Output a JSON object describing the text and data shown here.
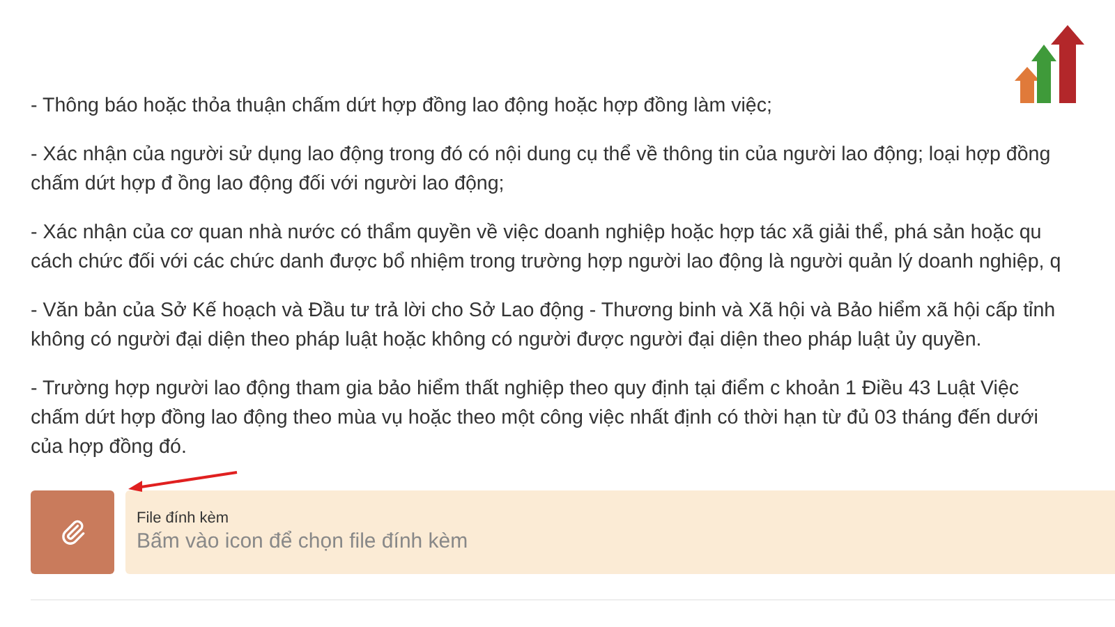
{
  "paragraphs": [
    {
      "lines": [
        "- Thông báo hoặc thỏa thuận chấm dứt hợp đồng lao động hoặc hợp đồng làm việc;"
      ]
    },
    {
      "lines": [
        "- Xác nhận của người sử dụng lao động trong đó có nội dung cụ thể về thông tin của người lao động; loại hợp đồng",
        "chấm dứt hợp đ ồng lao động đối với người lao động;"
      ]
    },
    {
      "lines": [
        "- Xác nhận của cơ quan nhà nước có thẩm quyền về việc doanh nghiệp hoặc hợp tác xã giải thể, phá sản hoặc qu",
        "cách chức đối với các chức danh được bổ nhiệm trong trường hợp người lao động là người quản lý doanh nghiệp, q"
      ]
    },
    {
      "lines": [
        "- Văn bản của Sở Kế hoạch và Đầu tư trả lời cho Sở Lao động - Thương binh và Xã hội và Bảo hiểm xã hội cấp tỉnh",
        "không có người đại diện theo pháp luật hoặc không có người được người đại diện theo pháp luật ủy quyền."
      ]
    },
    {
      "lines": [
        "- Trường hợp người lao động tham gia bảo hiểm thất nghiệp theo quy định tại điểm c khoản 1 Điều 43 Luật Việc",
        "chấm dứt hợp đồng lao động theo mùa vụ hoặc theo một công việc nhất định có thời hạn từ đủ 03 tháng đến dưới",
        "của hợp đồng đó."
      ]
    }
  ],
  "attachment": {
    "label": "File đính kèm",
    "placeholder": "Bấm vào icon để chọn file đính kèm"
  }
}
